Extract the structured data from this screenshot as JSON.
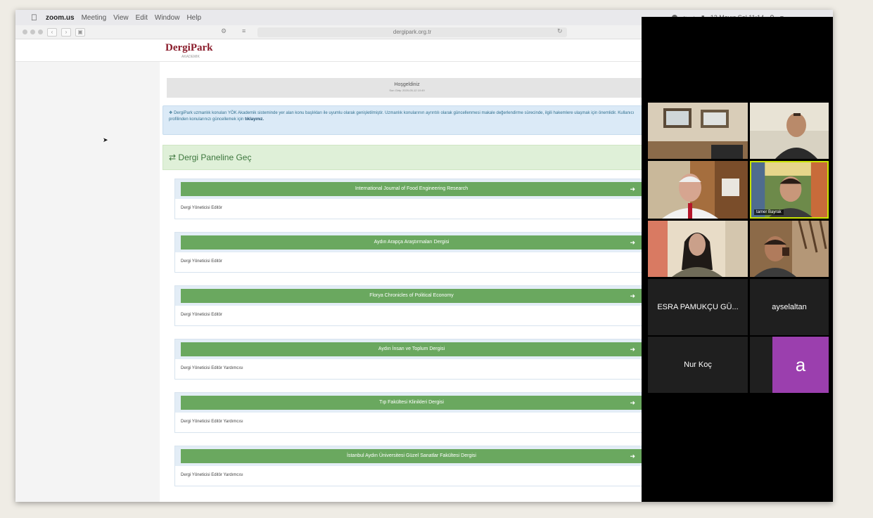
{
  "menubar": {
    "app": "zoom.us",
    "items": [
      "Meeting",
      "View",
      "Edit",
      "Window",
      "Help"
    ],
    "datetime": "12 Mayıs Sal 11:14"
  },
  "browser": {
    "url": "dergipark.org.tr"
  },
  "site": {
    "logo": "DergiPark",
    "logo_sub": "AKADEMIK"
  },
  "welcome": {
    "title": "Hoşgeldiniz",
    "subtitle": "Son Giriş: 2020-05-12 10:49"
  },
  "alert": {
    "text": "DergiPark uzmanlık konuları YÖK Akademik sisteminde yer alan konu başlıkları ile uyumlu olarak genişletilmiştir. Uzmanlık konularının ayrıntılı olarak güncellenmesi makale değerlendirme sürecinde, ilgili hakemlere ulaşmak için önemlidir. Kullanıcı profilinden konularınızı güncellemek için",
    "link": "tıklayınız."
  },
  "panel": {
    "heading": "Dergi Paneline Geç"
  },
  "journals": [
    {
      "name": "International Journal of Food Engineering Research",
      "role": "Dergi Yöneticisi Editör"
    },
    {
      "name": "Aydın Arapça Araştırmaları Dergisi",
      "role": "Dergi Yöneticisi Editör"
    },
    {
      "name": "Florya Chronicles of Political Economy",
      "role": "Dergi Yöneticisi Editör"
    },
    {
      "name": "Aydın İnsan ve Toplum Dergisi",
      "role": "Dergi Yöneticisi Editör Yardımcısı"
    },
    {
      "name": "Tıp Fakültesi Klinikleri Dergisi",
      "role": "Dergi Yöneticisi Editör Yardımcısı"
    },
    {
      "name": "İstanbul Aydın Üniversitesi Güzel Sanatlar Fakültesi Dergisi",
      "role": "Dergi Yöneticisi Editör Yardımcısı"
    }
  ],
  "zoom": {
    "video_name_tag": "tamer Bayrak",
    "participants": [
      "ESRA PAMUKÇU GÜ...",
      "ayselaltan",
      "Nur Koç"
    ],
    "avatar_letter": "a"
  }
}
